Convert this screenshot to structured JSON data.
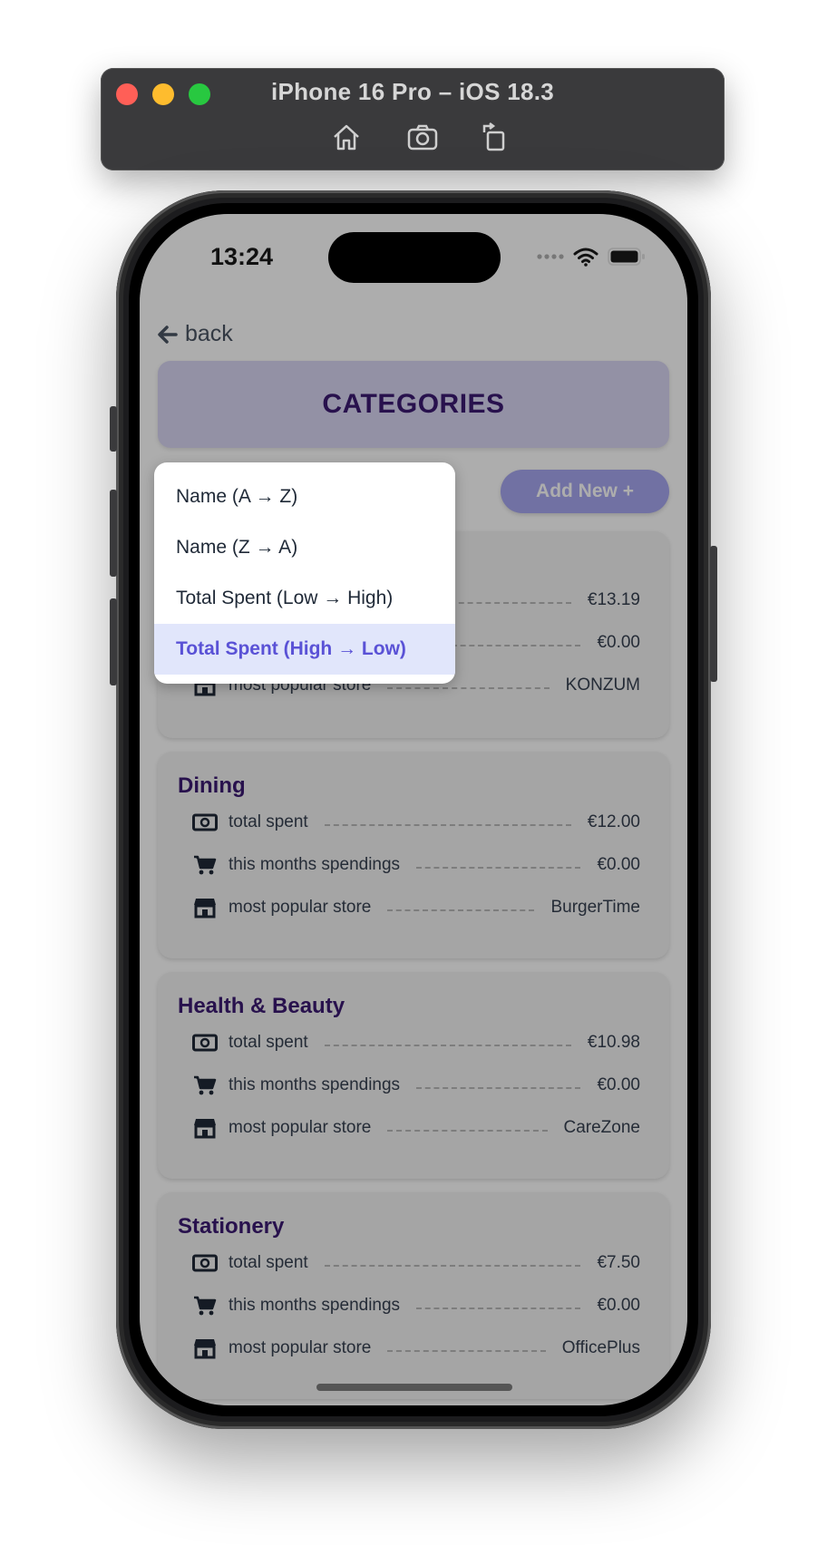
{
  "simulator": {
    "title": "iPhone 16 Pro – iOS 18.3",
    "tools": [
      "home-icon",
      "screenshot-icon",
      "rotate-icon"
    ]
  },
  "status_bar": {
    "time": "13:24",
    "icons": [
      "cellular-icon",
      "wifi-icon",
      "battery-icon"
    ]
  },
  "nav": {
    "back_label": "back"
  },
  "header": {
    "title": "CATEGORIES"
  },
  "add_button": {
    "label": "Add New +"
  },
  "sort_menu": {
    "items": [
      {
        "label": "Name (A → Z)",
        "selected": false
      },
      {
        "label": "Name (Z → A)",
        "selected": false
      },
      {
        "label": "Total Spent (Low → High)",
        "selected": false
      },
      {
        "label": "Total Spent (High → Low)",
        "selected": true
      }
    ]
  },
  "row_labels": {
    "total": "total spent",
    "month": "this months spendings",
    "store": "most popular store"
  },
  "categories": [
    {
      "name": "",
      "total": "€13.19",
      "month": "€0.00",
      "store": "KONZUM"
    },
    {
      "name": "Dining",
      "total": "€12.00",
      "month": "€0.00",
      "store": "BurgerTime"
    },
    {
      "name": "Health & Beauty",
      "total": "€10.98",
      "month": "€0.00",
      "store": "CareZone"
    },
    {
      "name": "Stationery",
      "total": "€7.50",
      "month": "€0.00",
      "store": "OfficePlus"
    }
  ],
  "colors": {
    "accent": "#5a52d6",
    "title_purple": "#3b1a72",
    "header_bg": "#d9d6f4",
    "add_button_bg": "#a7a7f0"
  }
}
